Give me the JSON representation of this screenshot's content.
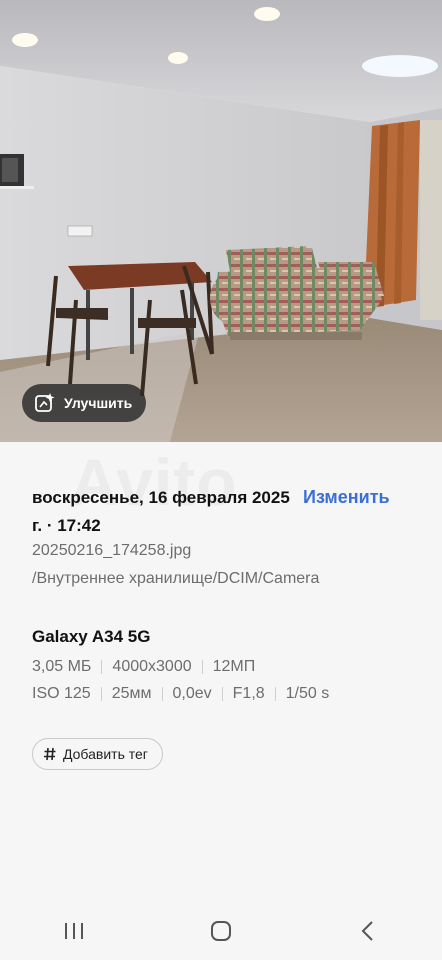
{
  "photo": {
    "enhance_label": "Улучшить"
  },
  "details": {
    "watermark": "Avito",
    "date": "воскресенье, 16 февраля 2025 г. · 17:42",
    "edit_label": "Изменить",
    "filename": "20250216_174258.jpg",
    "path": "/Внутреннее хранилище/DCIM/Camera",
    "device": "Galaxy A34 5G",
    "specs_row1": [
      "3,05 МБ",
      "4000x3000",
      "12МП"
    ],
    "specs_row2": [
      "ISO 125",
      "25мм",
      "0,0ev",
      "F1,8",
      "1/50 s"
    ],
    "tag_label": "Добавить тег"
  },
  "navbar": {
    "icons": [
      "recents-icon",
      "home-icon",
      "back-icon"
    ]
  },
  "colors": {
    "accent": "#3a6fd6",
    "muted_text": "#6d6d6d"
  }
}
